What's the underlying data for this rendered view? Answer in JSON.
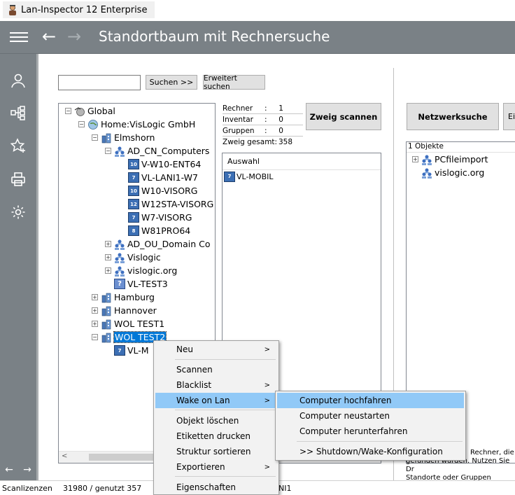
{
  "window": {
    "title": "Lan-Inspector 12 Enterprise"
  },
  "header": {
    "back_icon": "←",
    "forward_icon": "→",
    "title": "Standortbaum mit Rechnersuche"
  },
  "sidebar": {
    "items": [
      {
        "name": "user-icon"
      },
      {
        "name": "network-tree-icon"
      },
      {
        "name": "favorites-star-icon"
      },
      {
        "name": "printer-icon"
      },
      {
        "name": "settings-gear-icon"
      }
    ],
    "nav_back": "←",
    "nav_forward": "→"
  },
  "search": {
    "value": "",
    "search_button": "Suchen >>",
    "advanced_button": "Erweitert suchen"
  },
  "tree": {
    "items": [
      {
        "label": "Global",
        "icon": "globe-hand",
        "exp": "−"
      },
      {
        "label": "Home:VisLogic GmbH",
        "icon": "globe",
        "exp": "−"
      },
      {
        "label": "Elmshorn",
        "icon": "building",
        "exp": "−"
      },
      {
        "label": "AD_CN_Computers",
        "icon": "group",
        "exp": "−"
      },
      {
        "label": "V-W10-ENT64",
        "icon": "pc",
        "badge": "10"
      },
      {
        "label": "VL-LANI1-W7",
        "icon": "pc",
        "badge": "7"
      },
      {
        "label": "W10-VISORG",
        "icon": "pc",
        "badge": "10"
      },
      {
        "label": "W12STA-VISORG",
        "icon": "pc",
        "badge": "12"
      },
      {
        "label": "W7-VISORG",
        "icon": "pc",
        "badge": "7"
      },
      {
        "label": "W81PRO64",
        "icon": "pc",
        "badge": "8"
      },
      {
        "label": "AD_OU_Domain Co",
        "icon": "group",
        "exp": "+"
      },
      {
        "label": "Vislogic",
        "icon": "group",
        "exp": "+"
      },
      {
        "label": "vislogic.org",
        "icon": "group",
        "exp": "+"
      },
      {
        "label": "VL-TEST3",
        "icon": "question",
        "badge": "?"
      },
      {
        "label": "Hamburg",
        "icon": "building",
        "exp": "+"
      },
      {
        "label": "Hannover",
        "icon": "building",
        "exp": "+"
      },
      {
        "label": "WOL TEST1",
        "icon": "building",
        "exp": "+"
      },
      {
        "label": "WOL TEST2",
        "icon": "building",
        "exp": "−",
        "selected": true
      },
      {
        "label": "VL-M",
        "icon": "pc",
        "badge": "7"
      }
    ]
  },
  "stats": {
    "rows": [
      {
        "key": "Rechner",
        "sep": ":",
        "value": "1"
      },
      {
        "key": "Inventar",
        "sep": ":",
        "value": "0"
      },
      {
        "key": "Gruppen",
        "sep": ":",
        "value": "0"
      }
    ],
    "total_label": "Zweig gesamt:",
    "total_value": "358"
  },
  "buttons": {
    "zweig_scannen": "Zweig scannen",
    "netzwerksuche": "Netzwerksuche",
    "partial": "Eir"
  },
  "auswahl": {
    "header": "Auswahl",
    "items": [
      {
        "label": "VL-MOBIL",
        "badge": "7"
      }
    ]
  },
  "objekte": {
    "header": "1  Objekte",
    "items": [
      {
        "label": "PCfileimport",
        "exp": "+"
      },
      {
        "label": "vislogic.org",
        "exp": ""
      }
    ]
  },
  "info_text": {
    "line1": "Rechner, die",
    "line2": "gefunden wurden. Nutzen Sie Dr",
    "line3": "Standorte oder Gruppen einzuso"
  },
  "status": {
    "label": "Scanlizenzen",
    "value": "31980 / genutzt 357",
    "extra": "NI1"
  },
  "context_menu": {
    "items": [
      {
        "label": "Neu",
        "submenu": true
      },
      {
        "label": "Scannen",
        "submenu": false
      },
      {
        "label": "Blacklist",
        "submenu": true
      },
      {
        "label": "Wake on Lan",
        "submenu": true,
        "highlighted": true
      },
      {
        "label": "Objekt löschen",
        "submenu": false
      },
      {
        "label": "Etiketten drucken",
        "submenu": false
      },
      {
        "label": "Struktur sortieren",
        "submenu": false
      },
      {
        "label": "Exportieren",
        "submenu": true
      },
      {
        "label": "Eigenschaften",
        "submenu": false
      }
    ],
    "submenu_arrow": ">"
  },
  "wol_submenu": {
    "items": [
      {
        "label": "Computer hochfahren",
        "highlighted": true
      },
      {
        "label": "Computer neustarten"
      },
      {
        "label": "Computer herunterfahren"
      },
      {
        "label": ">> Shutdown/Wake-Konfiguration"
      }
    ]
  }
}
